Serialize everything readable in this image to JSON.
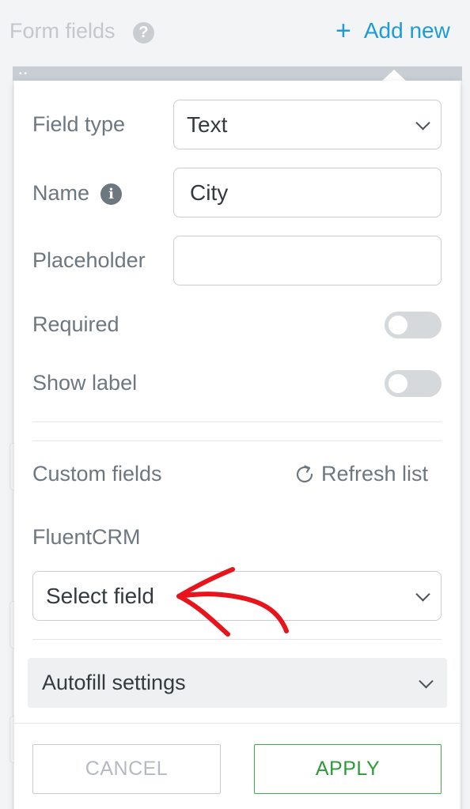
{
  "header": {
    "title": "Form fields",
    "help_icon": "question-circle-icon",
    "add_new_label": "Add new",
    "add_icon": "plus-icon"
  },
  "panel": {
    "field_type": {
      "label": "Field type",
      "value": "Text"
    },
    "name": {
      "label": "Name",
      "value": "City",
      "info_icon": "info-circle-icon"
    },
    "placeholder": {
      "label": "Placeholder",
      "value": ""
    },
    "required": {
      "label": "Required",
      "on": false
    },
    "show_label": {
      "label": "Show label",
      "on": false
    },
    "custom_fields": {
      "label": "Custom fields",
      "refresh_label": "Refresh list",
      "refresh_icon": "refresh-icon"
    },
    "fluentcrm": {
      "label": "FluentCRM",
      "select_value": "Select field"
    },
    "autofill": {
      "label": "Autofill settings"
    },
    "buttons": {
      "cancel": "CANCEL",
      "apply": "APPLY"
    }
  },
  "colors": {
    "accent_blue": "#1e9bd8",
    "apply_green": "#3fae49",
    "annotation_red": "#e8141b"
  }
}
